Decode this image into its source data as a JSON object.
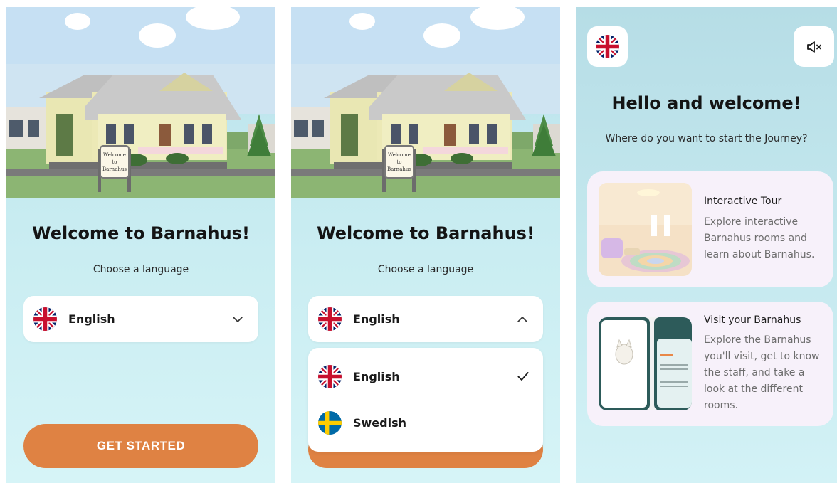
{
  "screen1": {
    "title": "Welcome to Barnahus!",
    "subtitle": "Choose a language",
    "sign_text": [
      "Welcome",
      "to",
      "Barnahus"
    ],
    "language_select": {
      "selected": "English",
      "flag": "uk-flag-icon",
      "chevron": "chevron-down-icon"
    },
    "cta_label": "GET STARTED"
  },
  "screen2": {
    "title": "Welcome to Barnahus!",
    "subtitle": "Choose a language",
    "sign_text": [
      "Welcome",
      "to",
      "Barnahus"
    ],
    "language_select": {
      "selected": "English",
      "flag": "uk-flag-icon",
      "chevron": "chevron-up-icon"
    },
    "options": [
      {
        "label": "English",
        "flag": "uk-flag-icon",
        "selected": true
      },
      {
        "label": "Swedish",
        "flag": "sweden-flag-icon",
        "selected": false
      }
    ]
  },
  "screen3": {
    "language_button_icon": "uk-flag-icon",
    "sound_button_icon": "mute-icon",
    "title": "Hello and welcome!",
    "subtitle": "Where do you want to start the Journey?",
    "cards": [
      {
        "title": "Interactive Tour",
        "description": "Explore interactive Barnahus rooms and learn about Barnahus."
      },
      {
        "title": "Visit your Barnahus",
        "description": "Explore the Barnahus you'll visit, get to know the staff, and take a look at the different rooms."
      }
    ]
  },
  "colors": {
    "accent_orange": "#df8243",
    "background_top": "#b9e1ea",
    "background_bottom": "#d6f4f7",
    "card_background": "#f7f1fa",
    "check_color": "#1a1a1a"
  }
}
